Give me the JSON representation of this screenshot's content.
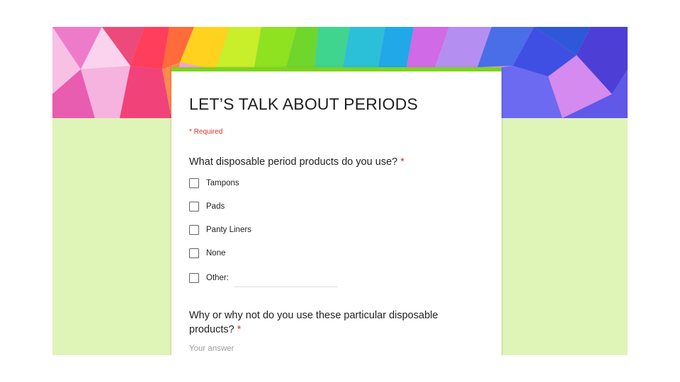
{
  "form": {
    "title": "LET’S TALK ABOUT PERIODS",
    "required_note": "* Required",
    "accent_color": "#7ed321",
    "background_color": "#dff5b8",
    "questions": [
      {
        "title": "What disposable period products do you use?",
        "required_marker": "*",
        "type": "checkbox",
        "options": [
          {
            "label": "Tampons",
            "checked": false
          },
          {
            "label": "Pads",
            "checked": false
          },
          {
            "label": "Panty Liners",
            "checked": false
          },
          {
            "label": "None",
            "checked": false
          },
          {
            "label": "Other:",
            "checked": false,
            "other_value": ""
          }
        ]
      },
      {
        "title": "Why or why not do you use these particular disposable products?",
        "required_marker": "*",
        "type": "short-answer",
        "value": "",
        "placeholder": "Your answer"
      }
    ]
  }
}
